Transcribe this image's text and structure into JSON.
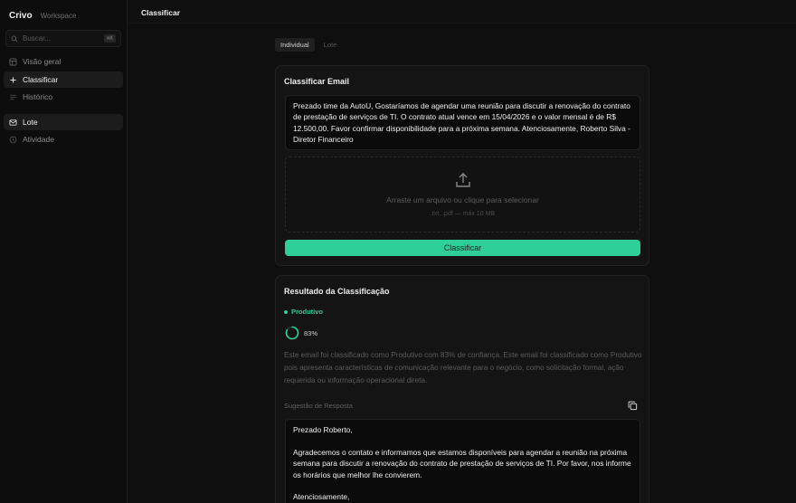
{
  "app": {
    "name": "Crivo",
    "workspace": "Workspace"
  },
  "search": {
    "placeholder": "Buscar...",
    "shortcut": "⌘K"
  },
  "sidebar": {
    "items": [
      {
        "label": "Visão geral",
        "icon": "grid-icon",
        "active": false
      },
      {
        "label": "Classificar",
        "icon": "plus-icon",
        "active": true
      },
      {
        "label": "Histórico",
        "icon": "list-icon",
        "active": false
      },
      {
        "label": "Lote",
        "icon": "mail-icon",
        "active": true
      },
      {
        "label": "Atividade",
        "icon": "clock-icon",
        "active": false
      }
    ]
  },
  "header": {
    "title": "Classificar"
  },
  "tabs": [
    {
      "label": "Individual",
      "active": true
    },
    {
      "label": "Lote",
      "active": false
    }
  ],
  "classify_card": {
    "title": "Classificar Email",
    "email_text": "Prezado time da AutoU, Gostaríamos de agendar uma reunião para discutir a renovação do contrato de prestação de serviços de TI. O contrato atual vence em 15/04/2026 e o valor mensal é de R$ 12.500,00. Favor confirmar disponibilidade para a próxima semana. Atenciosamente, Roberto Silva - Diretor Financeiro",
    "dropzone_text": "Arraste um arquivo ou clique para selecionar",
    "dropzone_hint": ".txt, .pdf — máx 10 MB",
    "button_label": "Classificar"
  },
  "result_card": {
    "title": "Resultado da Classificação",
    "category": "Produtivo",
    "confidence_label": "83%",
    "confidence_value": 0.83,
    "explanation": "Este email foi classificado como Produtivo com 83% de confiança. Este email foi classificado como Produtivo pois apresenta características de comunicação relevante para o negócio, como solicitação formal, ação requerida ou informação operacional direta.",
    "suggestion_label": "Sugestão de Resposta",
    "suggested_reply": "Prezado Roberto,\n\nAgradecemos o contato e informamos que estamos disponíveis para agendar a reunião na próxima semana para discutir a renovação do contrato de prestação de serviços de TI. Por favor, nos informe os horários que melhor lhe convierem.\n\nAtenciosamente,"
  },
  "colors": {
    "accent": "#2ecf98",
    "background": "#0f0f0f",
    "card": "#141414"
  }
}
